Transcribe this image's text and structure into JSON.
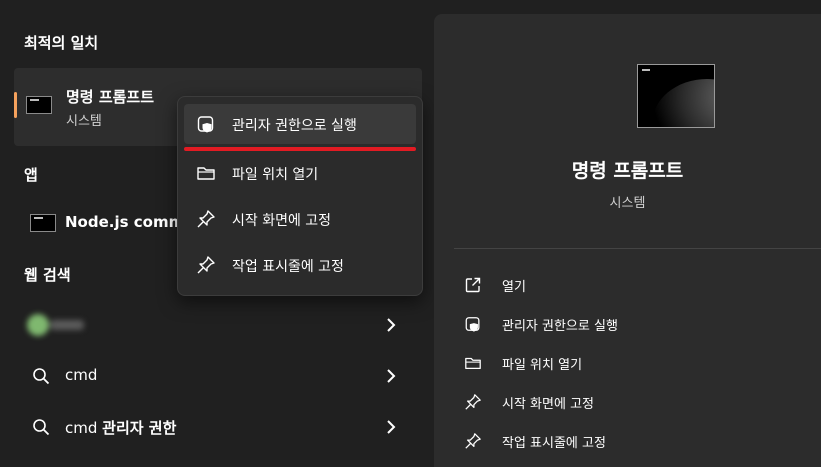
{
  "left": {
    "best_match_title": "최적의 일치",
    "best_match": {
      "name": "명령 프롬프트",
      "type": "시스템"
    },
    "apps_title": "앱",
    "apps": [
      {
        "label": "Node.js comm"
      }
    ],
    "web_title": "웹 검색",
    "web_items": [
      {
        "label": "",
        "blurred": true
      },
      {
        "label": "cmd",
        "bold_suffix": ""
      },
      {
        "label": "cmd",
        "bold_suffix": "관리자 권한"
      }
    ]
  },
  "context_menu": {
    "items": [
      {
        "label": "관리자 권한으로 실행",
        "icon": "shield-icon",
        "highlighted": true
      },
      {
        "label": "파일 위치 열기",
        "icon": "folder-icon"
      },
      {
        "label": "시작 화면에 고정",
        "icon": "pin-icon"
      },
      {
        "label": "작업 표시줄에 고정",
        "icon": "pin-icon"
      }
    ]
  },
  "right": {
    "name": "명령 프롬프트",
    "type": "시스템",
    "actions": [
      {
        "label": "열기",
        "icon": "open-external-icon"
      },
      {
        "label": "관리자 권한으로 실행",
        "icon": "shield-icon"
      },
      {
        "label": "파일 위치 열기",
        "icon": "folder-icon"
      },
      {
        "label": "시작 화면에 고정",
        "icon": "pin-icon"
      },
      {
        "label": "작업 표시줄에 고정",
        "icon": "pin-icon"
      }
    ]
  },
  "colors": {
    "accent": "#f5a25d",
    "highlight_underline": "#e21b23",
    "background": "#202020",
    "panel": "#2c2c2c"
  }
}
